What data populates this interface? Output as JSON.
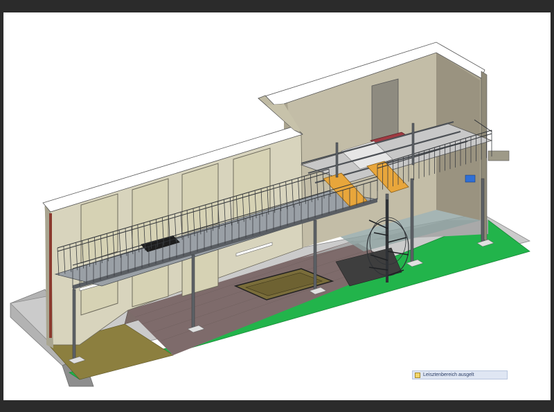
{
  "viewport": {
    "background": "#ffffff",
    "frame_color": "#2b2b2b",
    "view_type": "3D isometric model view"
  },
  "status": {
    "selection_text": "Leisztenbereich ausgelt",
    "icon": "selection-icon"
  },
  "colors": {
    "wall_light": "#d8d4bd",
    "wall_shade": "#b9b4a0",
    "window_panel": "#d6d2b4",
    "paving": "#7b6b69",
    "olive_floor": "#8b7e3e",
    "lawn": "#21b24a",
    "concrete": "#b8b8b8",
    "steel": "#5a5e63",
    "timber_bench": "#e8a63b",
    "downpipe_red": "#8b3a2e",
    "accent_blue": "#2f6fd6"
  }
}
